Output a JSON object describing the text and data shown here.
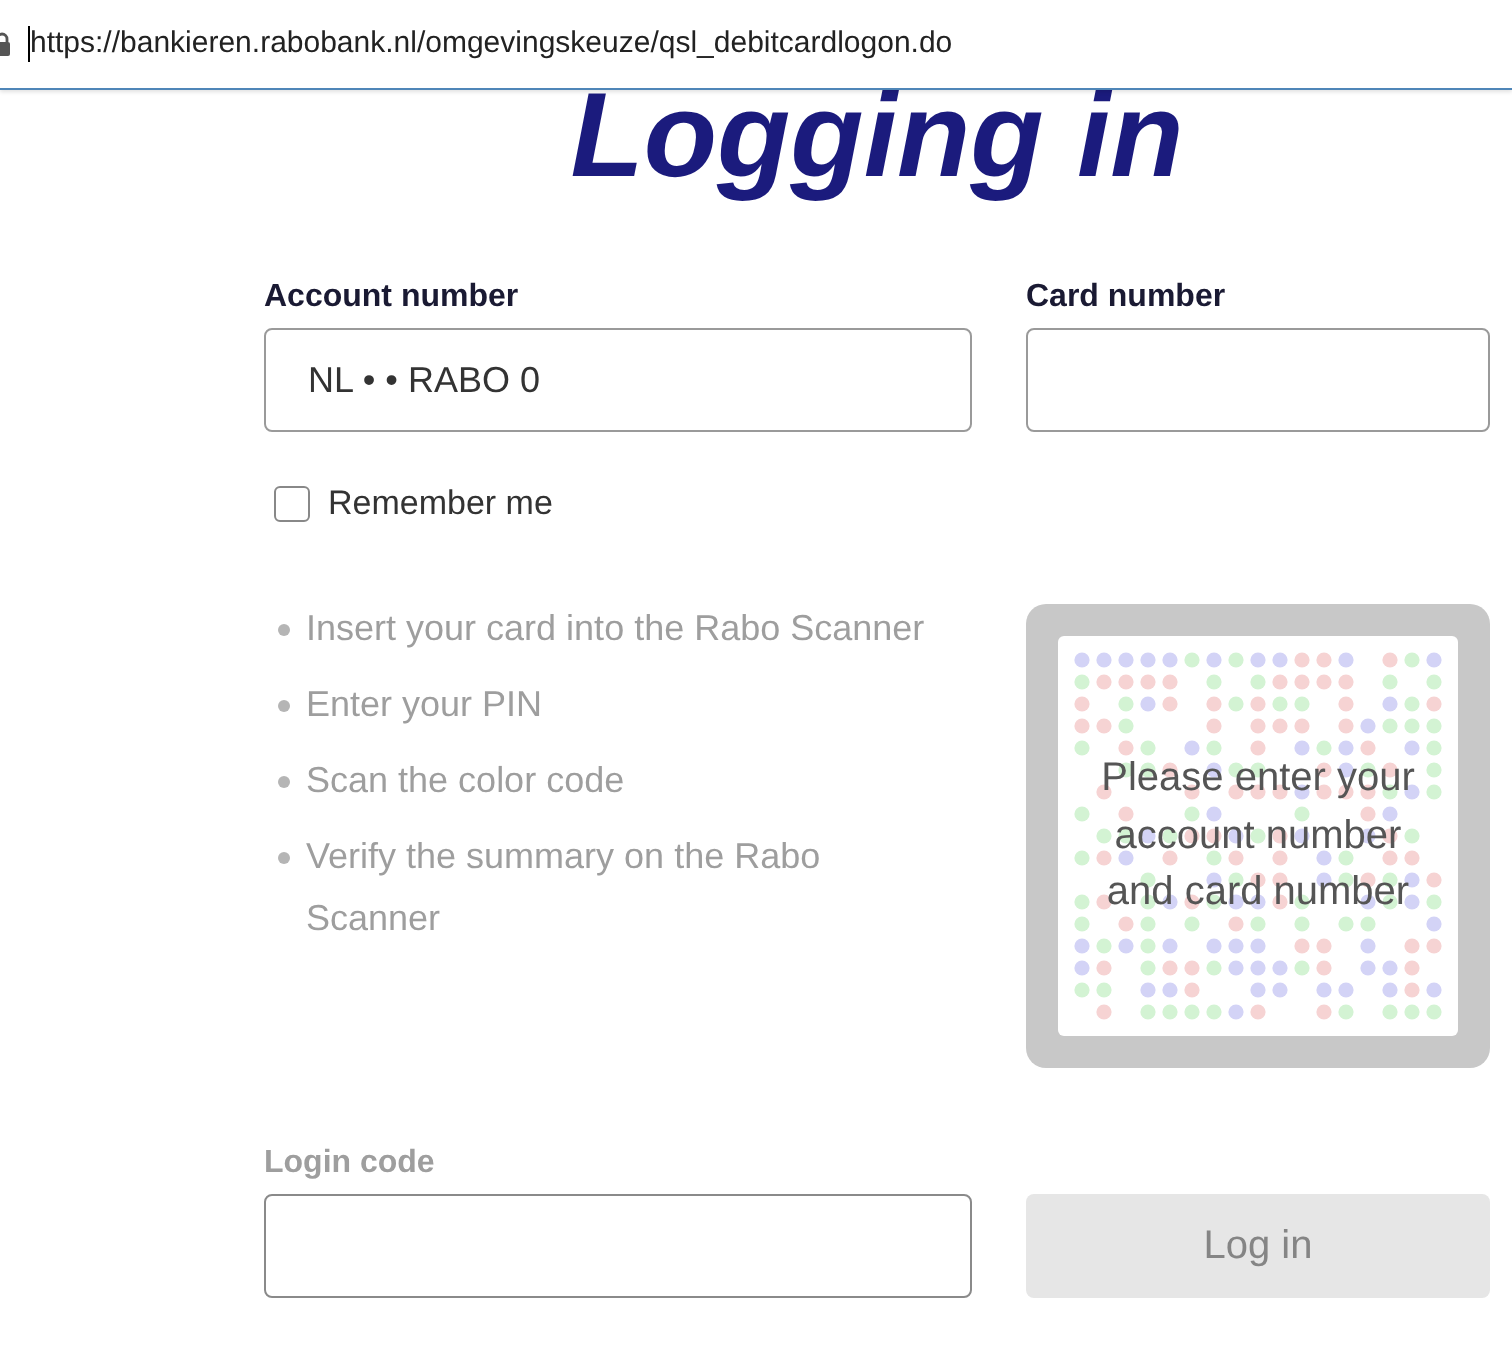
{
  "address_bar": {
    "url": "https://bankieren.rabobank.nl/omgevingskeuze/qsl_debitcardlogon.do"
  },
  "heading": "Logging in",
  "account_number": {
    "label": "Account number",
    "value": "NL • • RABO 0"
  },
  "card_number": {
    "label": "Card number"
  },
  "remember_me": {
    "label": "Remember me",
    "checked": false
  },
  "steps": {
    "disabled": true,
    "items": [
      "Insert your card into the Rabo Scanner",
      "Enter your PIN",
      "Scan the color code",
      "Verify the summary on the Rabo Scanner"
    ]
  },
  "color_code": {
    "message": "Please enter your account number and card number"
  },
  "login_code": {
    "label": "Login code",
    "disabled": true
  },
  "login_button": {
    "label": "Log in",
    "disabled": true
  }
}
